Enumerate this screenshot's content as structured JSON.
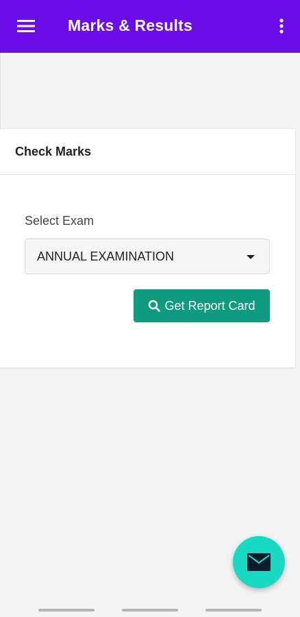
{
  "appbar": {
    "title": "Marks & Results",
    "menu_icon": "hamburger-menu-icon",
    "overflow_icon": "more-vertical-icon",
    "color": "#6a0de8"
  },
  "card": {
    "header": "Check Marks",
    "select_label": "Select Exam",
    "selected_exam": "ANNUAL EXAMINATION",
    "caret_icon": "dropdown-caret-icon",
    "report_button": "Get Report Card",
    "report_icon": "search-icon",
    "button_color": "#0f9b7f"
  },
  "fab": {
    "icon": "mail-icon",
    "color": "#17d9c4"
  }
}
